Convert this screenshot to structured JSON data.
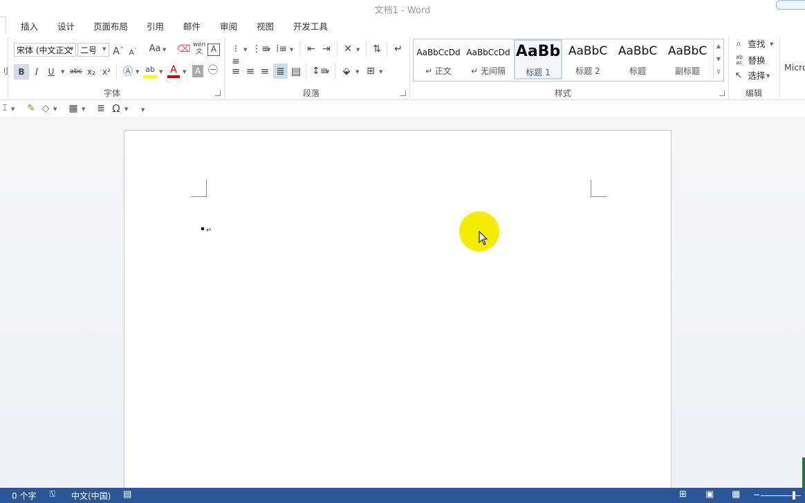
{
  "window": {
    "title": "文档1 - Word"
  },
  "tabs": [
    "插入",
    "设计",
    "页面布局",
    "引用",
    "邮件",
    "审阅",
    "视图",
    "开发工具"
  ],
  "font_group": {
    "font_name": "宋体 (中文正文",
    "font_size": "二号",
    "label": "字体",
    "grow_font": "A",
    "shrink_font": "A",
    "change_case": "Aa",
    "phonetic": "wén",
    "bold": "B",
    "italic": "I",
    "underline": "U",
    "strikethrough": "abc",
    "subscript": "x₂",
    "superscript": "x²",
    "font_color": "A"
  },
  "paragraph_group": {
    "label": "段落"
  },
  "styles_group": {
    "label": "样式",
    "items": [
      {
        "preview": "AaBbCcDd",
        "name": "↵ 正文"
      },
      {
        "preview": "AaBbCcDd",
        "name": "↵ 无间隔"
      },
      {
        "preview": "AaBb",
        "name": "标题 1"
      },
      {
        "preview": "AaBbC",
        "name": "标题 2"
      },
      {
        "preview": "AaBbC",
        "name": "标题"
      },
      {
        "preview": "AaBbC",
        "name": "副标题"
      }
    ]
  },
  "editing_group": {
    "label": "编辑",
    "find": "查找",
    "replace": "替换",
    "select": "选择",
    "replace_icon_text": "ab ac"
  },
  "partial_group_text": "Micro",
  "left_edge_label": "刂",
  "quick_access": {
    "omega": "Ω"
  },
  "document": {
    "cursor_mark": "↵"
  },
  "status": {
    "word_count": "0 个字",
    "language": "中文(中国)"
  },
  "colors": {
    "accent": "#2b579a",
    "highlight": "#f5ec00",
    "font_red": "#d00000",
    "highlight_yellow": "#ffff00"
  }
}
